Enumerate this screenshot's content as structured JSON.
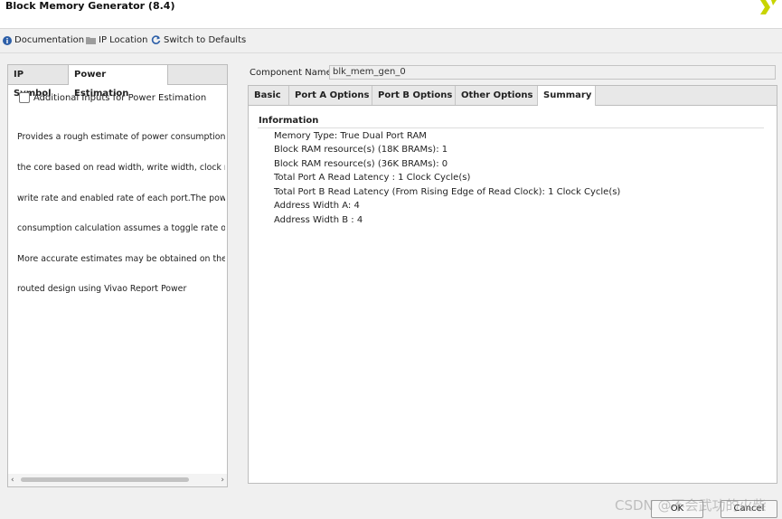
{
  "window": {
    "title": "Block Memory Generator (8.4)"
  },
  "toolbar": {
    "documentation": "Documentation",
    "ip_location": "IP Location",
    "switch_defaults": "Switch to Defaults"
  },
  "left_tabs": [
    "IP Symbol",
    "Power Estimation"
  ],
  "power": {
    "checkbox_label": "Additional Inputs for Power Estimation",
    "checkbox_checked": false,
    "description_lines": [
      "Provides a rough estimate of power consumption",
      "the core based on read width, write width, clock ra",
      "write rate and enabled rate of each port.The powe",
      "consumption calculation assumes a toggle rate of",
      "More accurate estimates may be obtained on the",
      "routed design using Vivao Report Power"
    ]
  },
  "component": {
    "label": "Component Name",
    "value": "blk_mem_gen_0"
  },
  "right_tabs": [
    "Basic",
    "Port A Options",
    "Port B Options",
    "Other Options",
    "Summary"
  ],
  "summary": {
    "heading": "Information",
    "items": [
      "Memory Type: True Dual Port RAM",
      "Block RAM resource(s) (18K BRAMs): 1",
      "Block RAM resource(s) (36K BRAMs): 0",
      "Total Port A Read Latency : 1 Clock Cycle(s)",
      "Total Port B Read Latency (From Rising Edge of Read Clock): 1 Clock Cycle(s)",
      "Address Width A: 4",
      "Address Width B : 4"
    ]
  },
  "buttons": {
    "ok": "OK",
    "cancel": "Cancel"
  },
  "watermark": "CSDN @不会武功的火柴",
  "colors": {
    "accent": "#2d5fa8",
    "logo": "#c8d400"
  }
}
